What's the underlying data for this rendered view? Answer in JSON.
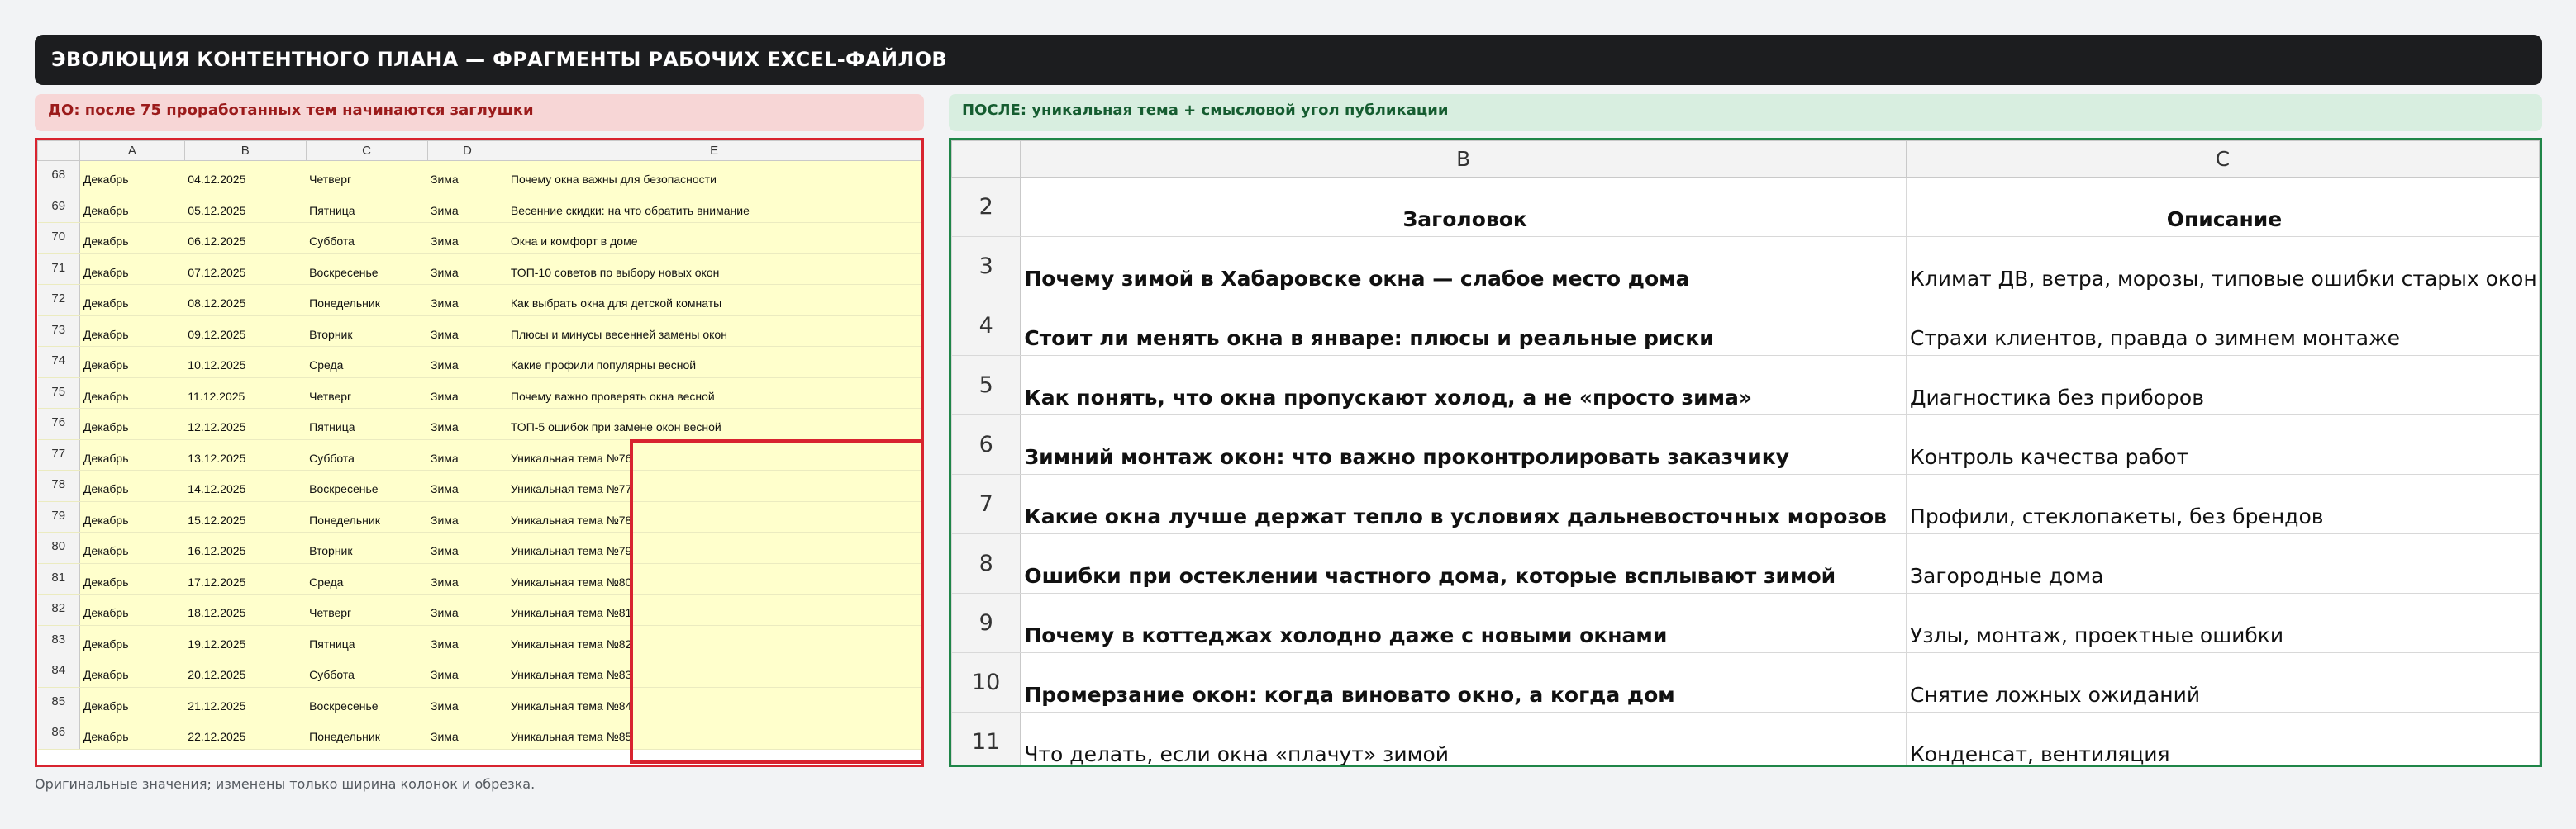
{
  "title": "ЭВОЛЮЦИЯ КОНТЕНТНОГО ПЛАНА — ФРАГМЕНТЫ РАБОЧИХ EXCEL-ФАЙЛОВ",
  "before_label": "ДО: после 75 проработанных тем начинаются заглушки",
  "after_label": "ПОСЛЕ: уникальная тема + смысловой угол публикации",
  "caption": "Оригинальные значения; изменены только ширина колонок и обрезка.",
  "left_sheet": {
    "columns": [
      "A",
      "B",
      "C",
      "D",
      "E"
    ],
    "rows": [
      {
        "n": "68",
        "cells": [
          "Декабрь",
          "04.12.2025",
          "Четверг",
          "Зима",
          "Почему окна важны для безопасности"
        ]
      },
      {
        "n": "69",
        "cells": [
          "Декабрь",
          "05.12.2025",
          "Пятница",
          "Зима",
          "Весенние скидки: на что обратить внимание"
        ]
      },
      {
        "n": "70",
        "cells": [
          "Декабрь",
          "06.12.2025",
          "Суббота",
          "Зима",
          "Окна и комфорт в доме"
        ]
      },
      {
        "n": "71",
        "cells": [
          "Декабрь",
          "07.12.2025",
          "Воскресенье",
          "Зима",
          "ТОП-10 советов по выбору новых окон"
        ]
      },
      {
        "n": "72",
        "cells": [
          "Декабрь",
          "08.12.2025",
          "Понедельник",
          "Зима",
          "Как выбрать окна для детской комнаты"
        ]
      },
      {
        "n": "73",
        "cells": [
          "Декабрь",
          "09.12.2025",
          "Вторник",
          "Зима",
          "Плюсы и минусы весенней замены окон"
        ]
      },
      {
        "n": "74",
        "cells": [
          "Декабрь",
          "10.12.2025",
          "Среда",
          "Зима",
          "Какие профили популярны весной"
        ]
      },
      {
        "n": "75",
        "cells": [
          "Декабрь",
          "11.12.2025",
          "Четверг",
          "Зима",
          "Почему важно проверять окна весной"
        ]
      },
      {
        "n": "76",
        "cells": [
          "Декабрь",
          "12.12.2025",
          "Пятница",
          "Зима",
          "ТОП-5 ошибок при замене окон весной"
        ]
      },
      {
        "n": "77",
        "cells": [
          "Декабрь",
          "13.12.2025",
          "Суббота",
          "Зима",
          "Уникальная тема №76"
        ]
      },
      {
        "n": "78",
        "cells": [
          "Декабрь",
          "14.12.2025",
          "Воскресенье",
          "Зима",
          "Уникальная тема №77"
        ]
      },
      {
        "n": "79",
        "cells": [
          "Декабрь",
          "15.12.2025",
          "Понедельник",
          "Зима",
          "Уникальная тема №78"
        ]
      },
      {
        "n": "80",
        "cells": [
          "Декабрь",
          "16.12.2025",
          "Вторник",
          "Зима",
          "Уникальная тема №79"
        ]
      },
      {
        "n": "81",
        "cells": [
          "Декабрь",
          "17.12.2025",
          "Среда",
          "Зима",
          "Уникальная тема №80"
        ]
      },
      {
        "n": "82",
        "cells": [
          "Декабрь",
          "18.12.2025",
          "Четверг",
          "Зима",
          "Уникальная тема №81"
        ]
      },
      {
        "n": "83",
        "cells": [
          "Декабрь",
          "19.12.2025",
          "Пятница",
          "Зима",
          "Уникальная тема №82"
        ]
      },
      {
        "n": "84",
        "cells": [
          "Декабрь",
          "20.12.2025",
          "Суббота",
          "Зима",
          "Уникальная тема №83"
        ]
      },
      {
        "n": "85",
        "cells": [
          "Декабрь",
          "21.12.2025",
          "Воскресенье",
          "Зима",
          "Уникальная тема №84"
        ]
      },
      {
        "n": "86",
        "cells": [
          "Декабрь",
          "22.12.2025",
          "Понедельник",
          "Зима",
          "Уникальная тема №85"
        ]
      }
    ]
  },
  "right_sheet": {
    "columns": [
      "B",
      "C"
    ],
    "header_row": {
      "n": "2",
      "cells": [
        "Заголовок",
        "Описание"
      ]
    },
    "rows": [
      {
        "n": "3",
        "cells": [
          "Почему зимой в Хабаровске окна — слабое место дома",
          "Климат ДВ, ветра, морозы, типовые ошибки старых окон"
        ]
      },
      {
        "n": "4",
        "cells": [
          "Стоит ли менять окна в январе: плюсы и реальные риски",
          "Страхи клиентов, правда о зимнем монтаже"
        ]
      },
      {
        "n": "5",
        "cells": [
          "Как понять, что окна пропускают холод, а не «просто зима»",
          "Диагностика без приборов"
        ]
      },
      {
        "n": "6",
        "cells": [
          "Зимний монтаж окон: что важно проконтролировать заказчику",
          "Контроль качества работ"
        ]
      },
      {
        "n": "7",
        "cells": [
          "Какие окна лучше держат тепло в условиях дальневосточных морозов",
          "Профили, стеклопакеты, без брендов"
        ]
      },
      {
        "n": "8",
        "cells": [
          "Ошибки при остеклении частного дома, которые всплывают зимой",
          "Загородные дома"
        ]
      },
      {
        "n": "9",
        "cells": [
          "Почему в коттеджах холодно даже с новыми окнами",
          "Узлы, монтаж, проектные ошибки"
        ]
      },
      {
        "n": "10",
        "cells": [
          "Промерзание окон: когда виновато окно, а когда дом",
          "Снятие ложных ожиданий"
        ]
      },
      {
        "n": "11",
        "cells": [
          "Что делать, если окна «плачут» зимой",
          "Конденсат, вентиляция"
        ]
      }
    ],
    "bold_title_rows": 8
  },
  "colors": {
    "before_accent": "#d8232f",
    "after_accent": "#1f8548",
    "cell_fill": "#ffffcc"
  }
}
